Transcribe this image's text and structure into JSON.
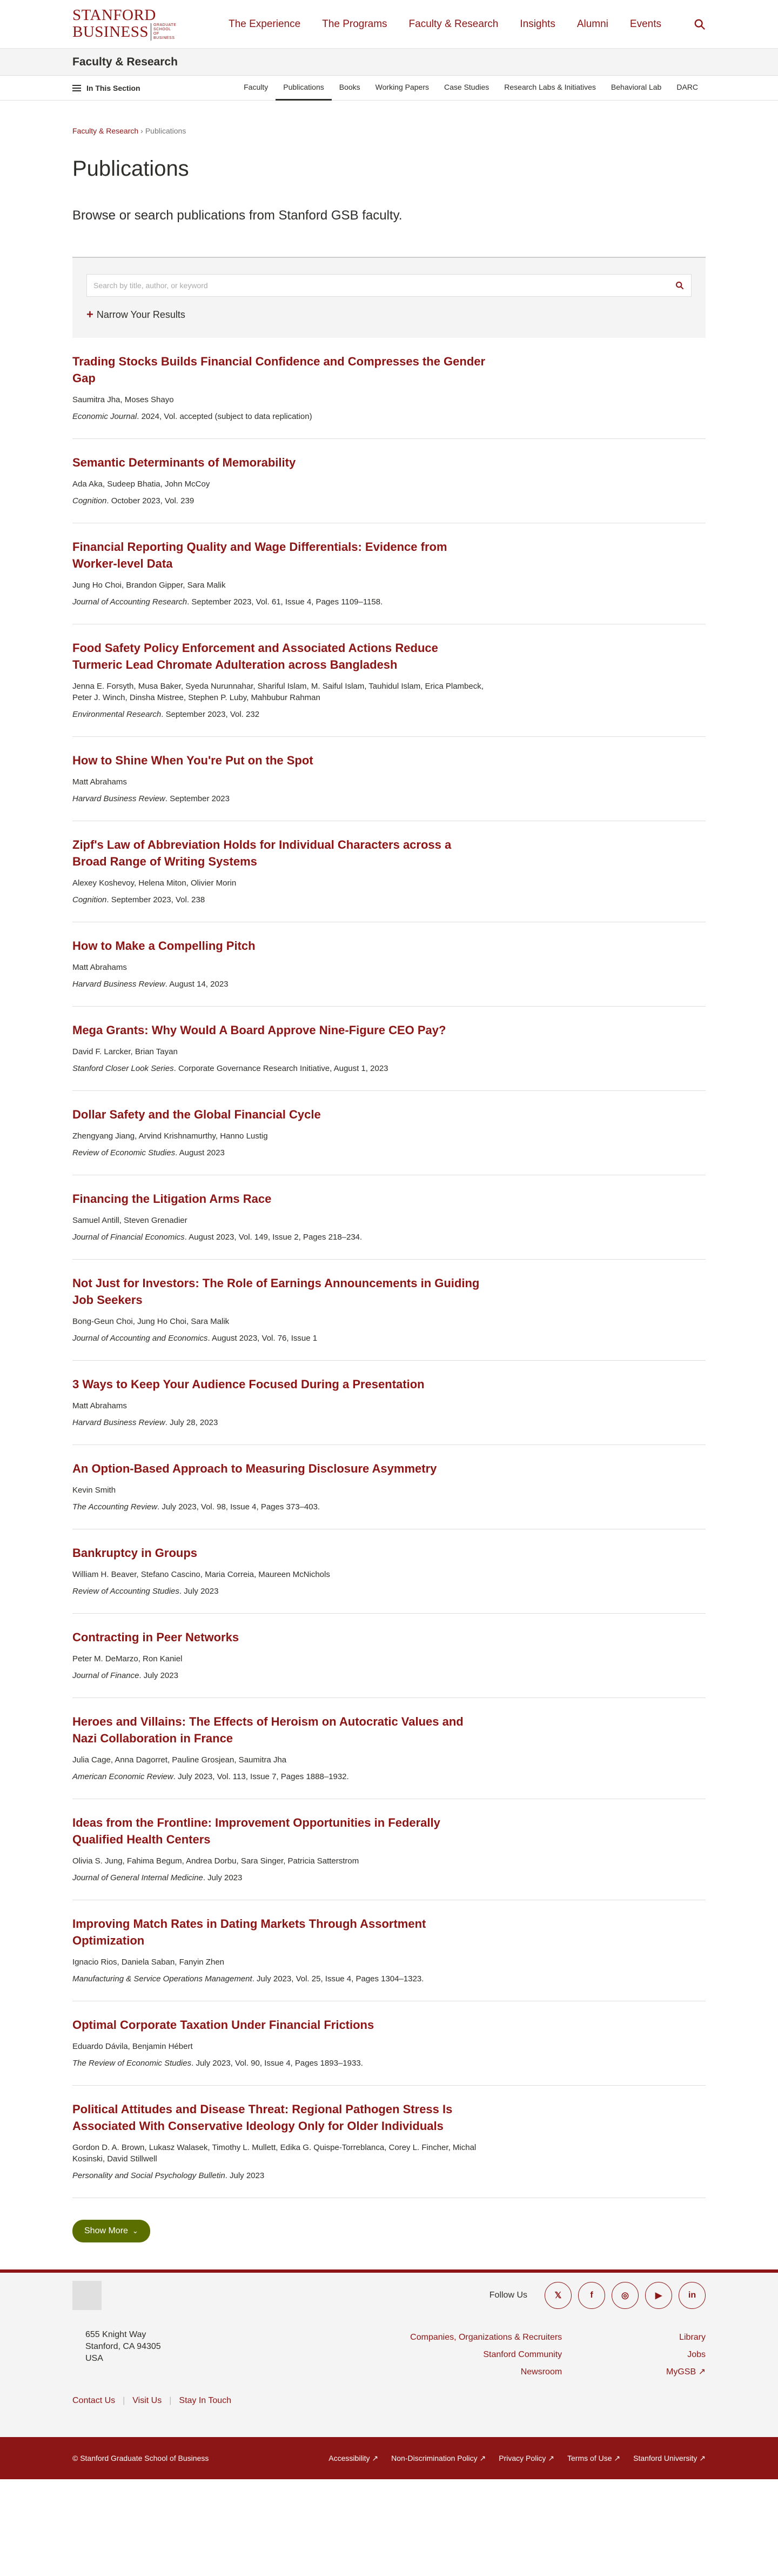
{
  "header": {
    "logo_line1": "STANFORD",
    "logo_line2": "BUSINESS",
    "logo_small": "GRADUATE SCHOOL OF BUSINESS",
    "nav": [
      "The Experience",
      "The Programs",
      "Faculty & Research",
      "Insights",
      "Alumni",
      "Events"
    ],
    "search_icon": "search-icon"
  },
  "section_header": {
    "title": "Faculty & Research"
  },
  "section_nav": {
    "in_this_section": "In This Section",
    "items": [
      "Faculty",
      "Publications",
      "Books",
      "Working Papers",
      "Case Studies",
      "Research Labs & Initiatives",
      "Behavioral Lab",
      "DARC"
    ],
    "active": "Publications"
  },
  "breadcrumb": {
    "parent": "Faculty & Research",
    "separator": "›",
    "current": "Publications"
  },
  "page": {
    "title": "Publications",
    "intro": "Browse or search publications from Stanford GSB faculty."
  },
  "search": {
    "placeholder": "Search by title, author, or keyword",
    "narrow_label": "Narrow Your Results"
  },
  "publications": [
    {
      "title": "Trading Stocks Builds Financial Confidence and Compresses the Gender Gap",
      "authors": "Saumitra Jha, Moses Shayo",
      "journal": "Economic Journal",
      "details": ". 2024, Vol. accepted (subject to data replication)"
    },
    {
      "title": "Semantic Determinants of Memorability",
      "authors": "Ada Aka, Sudeep Bhatia, John McCoy",
      "journal": "Cognition",
      "details": ". October 2023, Vol. 239"
    },
    {
      "title": "Financial Reporting Quality and Wage Differentials: Evidence from Worker-level Data",
      "authors": "Jung Ho Choi, Brandon Gipper, Sara Malik",
      "journal": "Journal of Accounting Research",
      "details": ". September 2023, Vol. 61, Issue 4, Pages 1109–1158."
    },
    {
      "title": "Food Safety Policy Enforcement and Associated Actions Reduce Turmeric Lead Chromate Adulteration across Bangladesh",
      "authors": "Jenna E. Forsyth, Musa Baker, Syeda Nurunnahar, Shariful Islam, M. Saiful Islam, Tauhidul Islam, Erica Plambeck, Peter J. Winch, Dinsha Mistree, Stephen P. Luby, Mahbubur Rahman",
      "journal": "Environmental Research",
      "details": ". September 2023, Vol. 232"
    },
    {
      "title": "How to Shine When You're Put on the Spot",
      "authors": "Matt Abrahams",
      "journal": "Harvard Business Review",
      "details": ". September 2023"
    },
    {
      "title": "Zipf's Law of Abbreviation Holds for Individual Characters across a Broad Range of Writing Systems",
      "authors": "Alexey Koshevoy, Helena Miton, Olivier Morin",
      "journal": "Cognition",
      "details": ". September 2023, Vol. 238"
    },
    {
      "title": "How to Make a Compelling Pitch",
      "authors": "Matt Abrahams",
      "journal": "Harvard Business Review",
      "details": ". August 14, 2023"
    },
    {
      "title": "Mega Grants: Why Would A Board Approve Nine-Figure CEO Pay?",
      "authors": "David F. Larcker, Brian Tayan",
      "journal": "Stanford Closer Look Series",
      "details": ". Corporate Governance Research Initiative, August 1, 2023"
    },
    {
      "title": "Dollar Safety and the Global Financial Cycle",
      "authors": "Zhengyang Jiang, Arvind Krishnamurthy, Hanno Lustig",
      "journal": "Review of Economic Studies",
      "details": ". August 2023"
    },
    {
      "title": "Financing the Litigation Arms Race",
      "authors": "Samuel Antill, Steven Grenadier",
      "journal": "Journal of Financial Economics",
      "details": ". August 2023, Vol. 149, Issue 2, Pages 218–234."
    },
    {
      "title": "Not Just for Investors: The Role of Earnings Announcements in Guiding Job Seekers",
      "authors": "Bong-Geun Choi, Jung Ho Choi, Sara Malik",
      "journal": "Journal of Accounting and Economics",
      "details": ". August 2023, Vol. 76, Issue 1"
    },
    {
      "title": "3 Ways to Keep Your Audience Focused During a Presentation",
      "authors": "Matt Abrahams",
      "journal": "Harvard Business Review",
      "details": ". July 28, 2023"
    },
    {
      "title": "An Option-Based Approach to Measuring Disclosure Asymmetry",
      "authors": "Kevin Smith",
      "journal": "The Accounting Review",
      "details": ". July 2023, Vol. 98, Issue 4, Pages 373–403."
    },
    {
      "title": "Bankruptcy in Groups",
      "authors": "William H. Beaver, Stefano Cascino, Maria Correia, Maureen McNichols",
      "journal": "Review of Accounting Studies",
      "details": ". July 2023"
    },
    {
      "title": "Contracting in Peer Networks",
      "authors": "Peter M. DeMarzo, Ron Kaniel",
      "journal": "Journal of Finance",
      "details": ". July 2023"
    },
    {
      "title": "Heroes and Villains: The Effects of Heroism on Autocratic Values and Nazi Collaboration in France",
      "authors": "Julia Cage, Anna Dagorret, Pauline Grosjean, Saumitra Jha",
      "journal": "American Economic Review",
      "details": ". July 2023, Vol. 113, Issue 7, Pages 1888–1932."
    },
    {
      "title": "Ideas from the Frontline: Improvement Opportunities in Federally Qualified Health Centers",
      "authors": "Olivia S. Jung, Fahima Begum, Andrea Dorbu, Sara Singer, Patricia Satterstrom",
      "journal": "Journal of General Internal Medicine",
      "details": ". July 2023"
    },
    {
      "title": "Improving Match Rates in Dating Markets Through Assortment Optimization",
      "authors": "Ignacio Rios, Daniela Saban, Fanyin Zhen",
      "journal": "Manufacturing & Service Operations Management",
      "details": ". July 2023, Vol. 25, Issue 4, Pages 1304–1323."
    },
    {
      "title": "Optimal Corporate Taxation Under Financial Frictions",
      "authors": "Eduardo Dávila, Benjamin Hébert",
      "journal": "The Review of Economic Studies",
      "details": ". July 2023, Vol. 90, Issue 4, Pages 1893–1933."
    },
    {
      "title": "Political Attitudes and Disease Threat: Regional Pathogen Stress Is Associated With Conservative Ideology Only for Older Individuals",
      "authors": "Gordon D. A. Brown, Lukasz Walasek, Timothy L. Mullett, Edika G. Quispe-Torreblanca, Corey L. Fincher, Michal Kosinski, David Stillwell",
      "journal": "Personality and Social Psychology Bulletin",
      "details": ". July 2023"
    }
  ],
  "show_more": "Show More",
  "footer": {
    "follow_label": "Follow Us",
    "social_icons": [
      "twitter-icon",
      "facebook-icon",
      "instagram-icon",
      "youtube-icon",
      "linkedin-icon"
    ],
    "social_glyphs": [
      "𝕏",
      "f",
      "◎",
      "▶",
      "in"
    ],
    "address": [
      "655 Knight Way",
      "Stanford, CA 94305",
      "USA"
    ],
    "links_mid": [
      "Companies, Organizations & Recruiters",
      "Stanford Community",
      "Newsroom"
    ],
    "links_right": [
      "Library",
      "Jobs",
      "MyGSB ↗"
    ],
    "bottom_links": [
      "Contact Us",
      "Visit Us",
      "Stay In Touch"
    ]
  },
  "legal": {
    "copyright": "© Stanford Graduate School of Business",
    "links": [
      "Accessibility ↗",
      "Non-Discrimination Policy ↗",
      "Privacy Policy ↗",
      "Terms of Use ↗",
      "Stanford University ↗"
    ]
  },
  "colors": {
    "brand": "#8c1515",
    "button": "#5b6f00"
  }
}
